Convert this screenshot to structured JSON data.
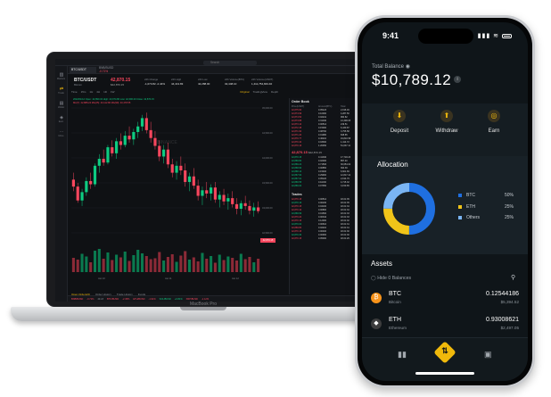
{
  "laptop": {
    "brand_label": "MacBook Pro",
    "search_placeholder": "Search",
    "sidebar": [
      {
        "icon": "markets-icon",
        "label": "Markets"
      },
      {
        "icon": "trade-icon",
        "label": "Trade"
      },
      {
        "icon": "wallet-icon",
        "label": "Wallet"
      },
      {
        "icon": "earn-icon",
        "label": "Earn"
      },
      {
        "icon": "more-icon",
        "label": "More"
      }
    ],
    "pair_tab": "BTC/USDT",
    "pair_tab2": "BNB/BUSD",
    "pair_tab2_change": "-0.71%",
    "ticker": {
      "pair": "BTC/USDT",
      "sub": "Bitcoin",
      "price": "42,870.15",
      "price_usd": "$42,870.15",
      "stats": [
        {
          "label": "24h Change",
          "value": "-1,073.82 -2.44%"
        },
        {
          "label": "24h High",
          "value": "44,413.83"
        },
        {
          "label": "24h Low",
          "value": "42,288.00"
        },
        {
          "label": "24h Volume(BTC)",
          "value": "32,448.10"
        },
        {
          "label": "24h Volume(USDT)",
          "value": "1,411,754,843.40"
        }
      ]
    },
    "chart_toolbar": {
      "intervals": [
        "Time",
        "15m",
        "1H",
        "4H",
        "1D",
        "1W"
      ],
      "views": [
        "Original",
        "TradingView",
        "Depth"
      ],
      "active_view": "Original"
    },
    "chart_legend": [
      "2022/01/12 Open: 42,890.32 High: 43,074.80 Low: 42,696.20 Close: 42,870.15",
      "MA(7): 42,888.24 MA(25): 43,112.80 MA(99): 43,478.55"
    ],
    "watermark": "BINANCE",
    "price_tag": "42,870.15",
    "bottom_tabs": [
      "Open Orders(0)",
      "Order History",
      "Trade History",
      "Funds"
    ],
    "active_bottom_tab": "Open Orders(0)",
    "orderbook": {
      "title": "Order Book",
      "headers": [
        "Price(USDT)",
        "Amount(BTC)",
        "Total"
      ],
      "asks": [
        [
          "42,875.60",
          "0.05123",
          "2,196.49"
        ],
        [
          "42,874.99",
          "0.10000",
          "4,287.50"
        ],
        [
          "42,874.50",
          "0.02241",
          "960.82"
        ],
        [
          "42,873.88",
          "0.31040",
          "13,308.05"
        ],
        [
          "42,873.10",
          "0.00512",
          "219.51"
        ],
        [
          "42,872.45",
          "0.15000",
          "6,430.87"
        ],
        [
          "42,871.90",
          "0.08760",
          "3,755.58"
        ],
        [
          "42,871.20",
          "0.01980",
          "848.85"
        ],
        [
          "42,870.77",
          "0.46210",
          "19,810.58"
        ],
        [
          "42,870.40",
          "0.03300",
          "1,414.72"
        ],
        [
          "42,870.16",
          "1.20450",
          "51,637.11"
        ]
      ],
      "mid_price": "42,870.15",
      "mid_usd": "$42,870.15",
      "bids": [
        [
          "42,870.15",
          "0.41330",
          "17,718.23"
        ],
        [
          "42,869.80",
          "0.02000",
          "857.40"
        ],
        [
          "42,869.22",
          "0.71506",
          "30,654.02"
        ],
        [
          "42,868.90",
          "0.00850",
          "364.39"
        ],
        [
          "42,868.14",
          "0.15400",
          "6,601.69"
        ],
        [
          "42,867.60",
          "0.29900",
          "12,817.41"
        ],
        [
          "42,867.01",
          "0.05120",
          "2,194.79"
        ],
        [
          "42,866.55",
          "0.11000",
          "4,715.32"
        ],
        [
          "42,866.00",
          "0.07350",
          "3,150.65"
        ]
      ],
      "trades_title": "Trades",
      "trades": [
        [
          "42,870.15",
          "0.00512",
          "18:21:35"
        ],
        [
          "42,870.16",
          "0.00230",
          "18:21:35"
        ],
        [
          "42,870.15",
          "0.04100",
          "18:21:34"
        ],
        [
          "42,870.10",
          "0.00800",
          "18:21:34"
        ],
        [
          "42,869.99",
          "0.01500",
          "18:21:33"
        ],
        [
          "42,870.20",
          "0.00342",
          "18:21:33"
        ],
        [
          "42,870.15",
          "0.12000",
          "18:21:32"
        ],
        [
          "42,870.00",
          "0.00610",
          "18:21:31"
        ],
        [
          "42,869.80",
          "0.02210",
          "18:21:31"
        ],
        [
          "42,870.15",
          "0.00400",
          "18:21:30"
        ],
        [
          "42,870.30",
          "0.00900",
          "18:21:30"
        ],
        [
          "42,870.15",
          "0.05000",
          "18:21:29"
        ]
      ]
    },
    "status_bar": [
      {
        "t": "BNB/BUSD",
        "c": "r"
      },
      {
        "t": "-0.71%",
        "c": "r"
      },
      {
        "t": "441.8",
        "c": ""
      },
      {
        "t": "BTC/BUSD",
        "c": "r"
      },
      {
        "t": "-2.45%",
        "c": "r"
      },
      {
        "t": "ETH/BUSD",
        "c": "r"
      },
      {
        "t": "-1.91%",
        "c": "r"
      },
      {
        "t": "SOL/BUSD",
        "c": "g"
      },
      {
        "t": "+0.81%",
        "c": "g"
      },
      {
        "t": "XRP/BUSD",
        "c": "r"
      },
      {
        "t": "-1.12%",
        "c": "r"
      }
    ]
  },
  "phone": {
    "time": "9:41",
    "total_balance_label": "Total Balance",
    "balance": "$10,789.12",
    "actions": [
      {
        "label": "Deposit",
        "icon": "deposit-icon",
        "glyph": "⬇"
      },
      {
        "label": "Withdraw",
        "icon": "withdraw-icon",
        "glyph": "⬆"
      },
      {
        "label": "Earn",
        "icon": "earn-icon",
        "glyph": "◎"
      }
    ],
    "allocation": {
      "title": "Allocation",
      "items": [
        {
          "name": "BTC",
          "percent": 50,
          "label": "50%",
          "color": "#1f6fe0"
        },
        {
          "name": "ETH",
          "percent": 25,
          "label": "25%",
          "color": "#f0c419"
        },
        {
          "name": "Others",
          "percent": 25,
          "label": "25%",
          "color": "#7ab5f3"
        }
      ]
    },
    "assets": {
      "title": "Assets",
      "hide_label": "Hide 0 Balances",
      "rows": [
        {
          "symbol": "BTC",
          "name": "Bitcoin",
          "amount": "0.12544186",
          "usd": "$5,394.52",
          "color": "#f7931a",
          "glyph": "₿"
        },
        {
          "symbol": "ETH",
          "name": "Ethereum",
          "amount": "0.93008621",
          "usd": "$2,497.05",
          "color": "#3c3c3d",
          "glyph": "◆"
        }
      ]
    },
    "nav": [
      "markets-icon",
      "trade-icon",
      "wallet-icon"
    ]
  },
  "chart_data": {
    "type": "candlestick",
    "candles_ohlc": [
      [
        43.55,
        43.7,
        43.3,
        43.4
      ],
      [
        43.4,
        43.48,
        43.05,
        43.1
      ],
      [
        43.1,
        43.35,
        42.98,
        43.28
      ],
      [
        43.28,
        43.6,
        43.2,
        43.52
      ],
      [
        43.52,
        43.7,
        43.35,
        43.45
      ],
      [
        43.45,
        43.9,
        43.4,
        43.85
      ],
      [
        43.85,
        44.1,
        43.7,
        44.0
      ],
      [
        44.0,
        44.2,
        43.85,
        43.92
      ],
      [
        43.92,
        44.3,
        43.88,
        44.25
      ],
      [
        44.25,
        44.4,
        44.05,
        44.12
      ],
      [
        44.12,
        44.45,
        44.0,
        44.38
      ],
      [
        44.38,
        44.55,
        44.2,
        44.3
      ],
      [
        44.3,
        44.6,
        44.25,
        44.5
      ],
      [
        44.5,
        44.7,
        44.35,
        44.42
      ],
      [
        44.42,
        44.65,
        44.3,
        44.58
      ],
      [
        44.58,
        44.8,
        44.45,
        44.7
      ],
      [
        44.7,
        44.95,
        44.6,
        44.88
      ],
      [
        44.88,
        45.0,
        44.55,
        44.62
      ],
      [
        44.62,
        44.8,
        44.35,
        44.45
      ],
      [
        44.45,
        44.6,
        44.2,
        44.28
      ],
      [
        44.28,
        44.4,
        43.95,
        44.05
      ],
      [
        44.05,
        44.3,
        43.9,
        44.2
      ],
      [
        44.2,
        44.35,
        43.8,
        43.88
      ],
      [
        43.88,
        44.0,
        43.6,
        43.7
      ],
      [
        43.7,
        43.95,
        43.55,
        43.85
      ],
      [
        43.85,
        44.05,
        43.65,
        43.75
      ],
      [
        43.75,
        43.9,
        43.4,
        43.5
      ],
      [
        43.5,
        43.7,
        43.3,
        43.62
      ],
      [
        43.62,
        43.8,
        43.35,
        43.42
      ],
      [
        43.42,
        43.55,
        43.1,
        43.2
      ],
      [
        43.2,
        43.4,
        43.0,
        43.32
      ],
      [
        43.32,
        43.5,
        43.15,
        43.25
      ],
      [
        43.25,
        43.45,
        43.1,
        43.38
      ],
      [
        43.38,
        43.5,
        43.05,
        43.12
      ],
      [
        43.12,
        43.3,
        42.95,
        43.22
      ],
      [
        43.22,
        43.35,
        43.0,
        43.08
      ],
      [
        43.08,
        43.25,
        42.9,
        43.15
      ],
      [
        43.15,
        43.3,
        42.95,
        43.02
      ],
      [
        43.02,
        43.15,
        42.8,
        42.92
      ],
      [
        42.92,
        43.1,
        42.78,
        43.04
      ],
      [
        43.04,
        43.2,
        42.9,
        42.98
      ],
      [
        42.98,
        43.1,
        42.8,
        42.88
      ],
      [
        42.88,
        43.05,
        42.75,
        42.95
      ],
      [
        42.95,
        43.08,
        42.82,
        42.87
      ]
    ],
    "price_axis": [
      "45,000.00",
      "44,500.00",
      "44,000.00",
      "43,500.00",
      "43,000.00",
      "42,500.00"
    ],
    "volume_values": [
      32,
      28,
      41,
      35,
      22,
      48,
      52,
      30,
      44,
      27,
      39,
      33,
      46,
      25,
      38,
      50,
      42,
      36,
      29,
      31,
      45,
      26,
      34,
      40,
      23,
      37,
      47,
      28,
      33,
      24,
      43,
      30,
      36,
      21,
      39,
      27,
      35,
      32,
      26,
      41,
      29,
      34,
      22,
      30
    ],
    "time_axis": [
      "Jan 10",
      "Jan 11",
      "Jan 12"
    ]
  }
}
